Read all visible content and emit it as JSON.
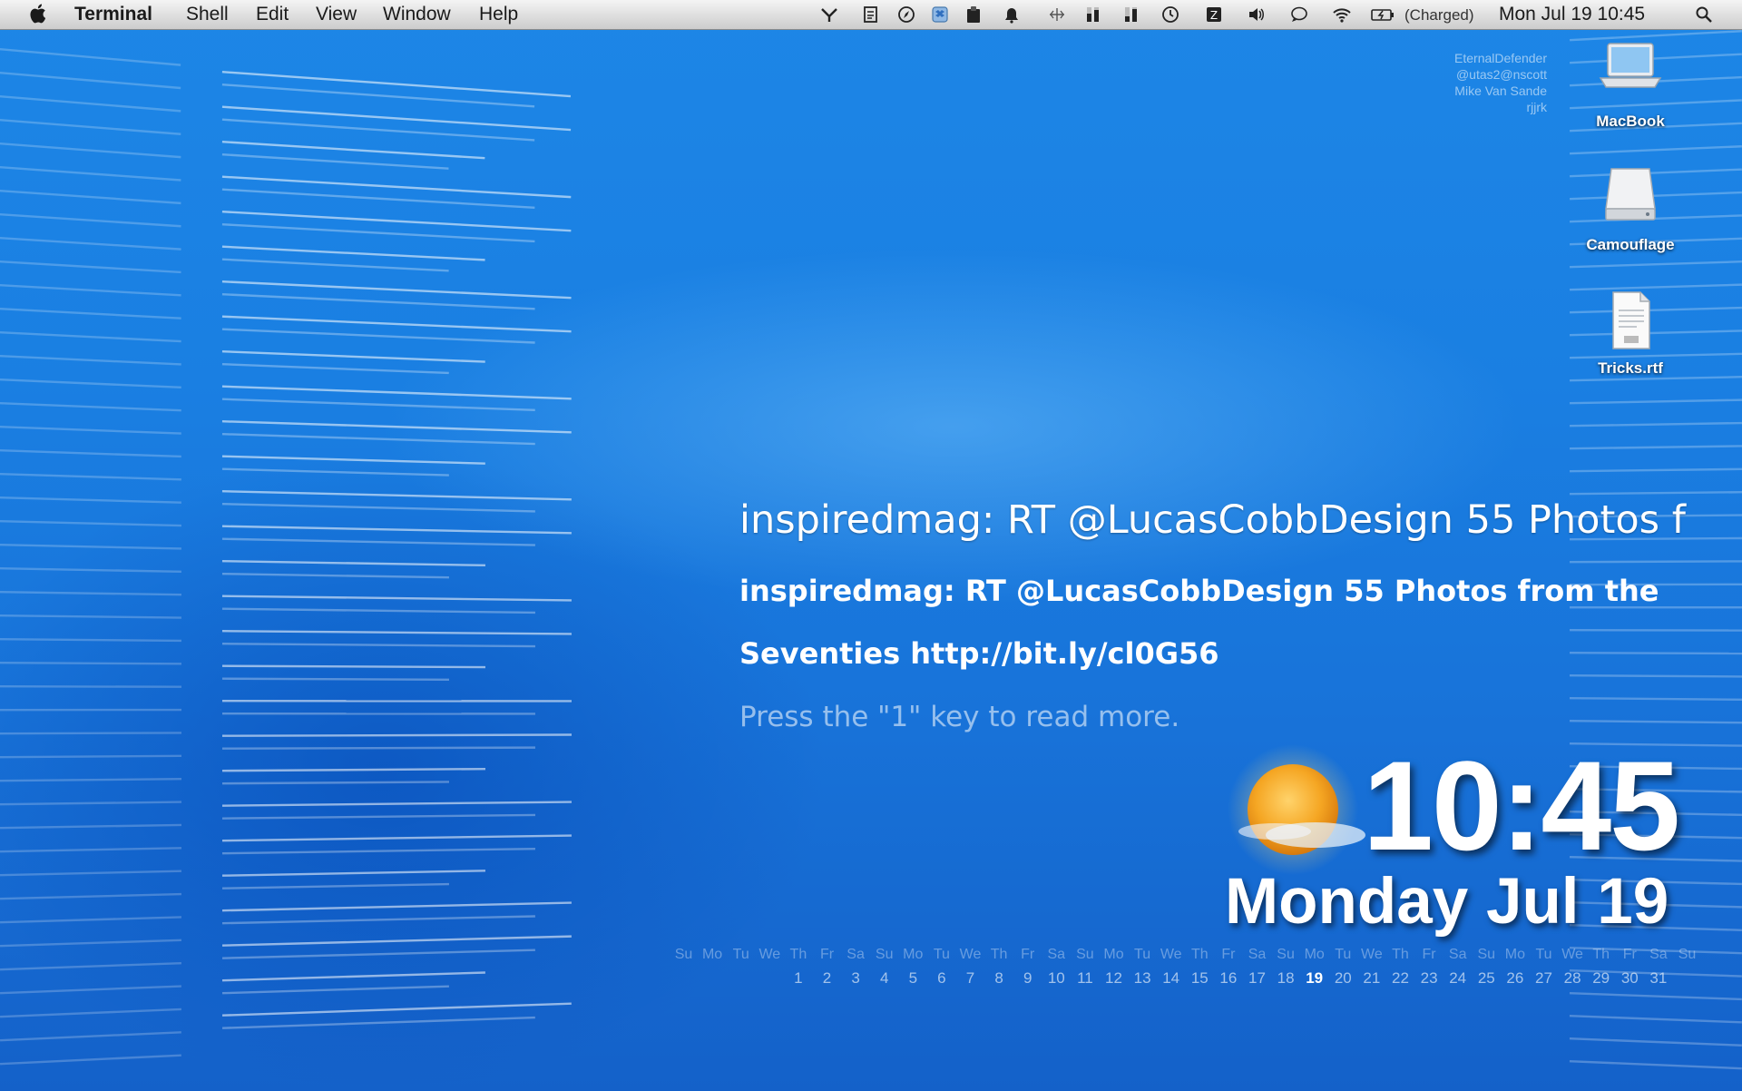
{
  "menubar": {
    "app_name": "Terminal",
    "menus": [
      "Shell",
      "Edit",
      "View",
      "Window",
      "Help"
    ],
    "battery_status": "(Charged)",
    "datetime": "Mon Jul 19  10:45"
  },
  "status_icons": [
    "growl-icon",
    "document-icon",
    "compass-icon",
    "dropbox-icon",
    "clipboard-icon",
    "bell-icon",
    "network-icon",
    "cpu-meter-icon",
    "memory-meter-icon",
    "time-machine-icon",
    "dashboard-icon",
    "volume-icon",
    "chat-bubble-icon",
    "wifi-icon",
    "battery-icon",
    "spotlight-icon"
  ],
  "credits": [
    "EternalDefender",
    "@utas2@nscott",
    "Mike Van Sande",
    "rjjrk"
  ],
  "desktop_icons": [
    {
      "label": "MacBook",
      "icon": "laptop-icon"
    },
    {
      "label": "Camouflage",
      "icon": "hard-drive-icon"
    },
    {
      "label": "Tricks.rtf",
      "icon": "rtf-document-icon"
    }
  ],
  "tweet": {
    "headline": "inspiredmag: RT @LucasCobbDesign 55 Photos f",
    "body_line1": "inspiredmag: RT @LucasCobbDesign 55 Photos from the",
    "body_line2": "Seventies http://bit.ly/cl0G56",
    "hint": "Press the \"1\" key to read more."
  },
  "clock": {
    "time": "10:45",
    "date": "Monday Jul 19",
    "weather_icon": "sunny-partly-cloudy-icon"
  },
  "calendar": {
    "day_names": [
      "Su",
      "Mo",
      "Tu",
      "We",
      "Th",
      "Fr",
      "Sa",
      "Su",
      "Mo",
      "Tu",
      "We",
      "Th",
      "Fr",
      "Sa",
      "Su",
      "Mo",
      "Tu",
      "We",
      "Th",
      "Fr",
      "Sa",
      "Su",
      "Mo",
      "Tu",
      "We",
      "Th",
      "Fr",
      "Sa",
      "Su",
      "Mo",
      "Tu",
      "We",
      "Th",
      "Fr",
      "Sa",
      "Su"
    ],
    "dates": [
      "",
      "",
      "",
      "",
      "1",
      "2",
      "3",
      "4",
      "5",
      "6",
      "7",
      "8",
      "9",
      "10",
      "11",
      "12",
      "13",
      "14",
      "15",
      "16",
      "17",
      "18",
      "19",
      "20",
      "21",
      "22",
      "23",
      "24",
      "25",
      "26",
      "27",
      "28",
      "29",
      "30",
      "31",
      ""
    ],
    "today": "19"
  },
  "colors": {
    "desktop_blue": "#1a7fe2",
    "menubar_gray": "#dedede"
  }
}
